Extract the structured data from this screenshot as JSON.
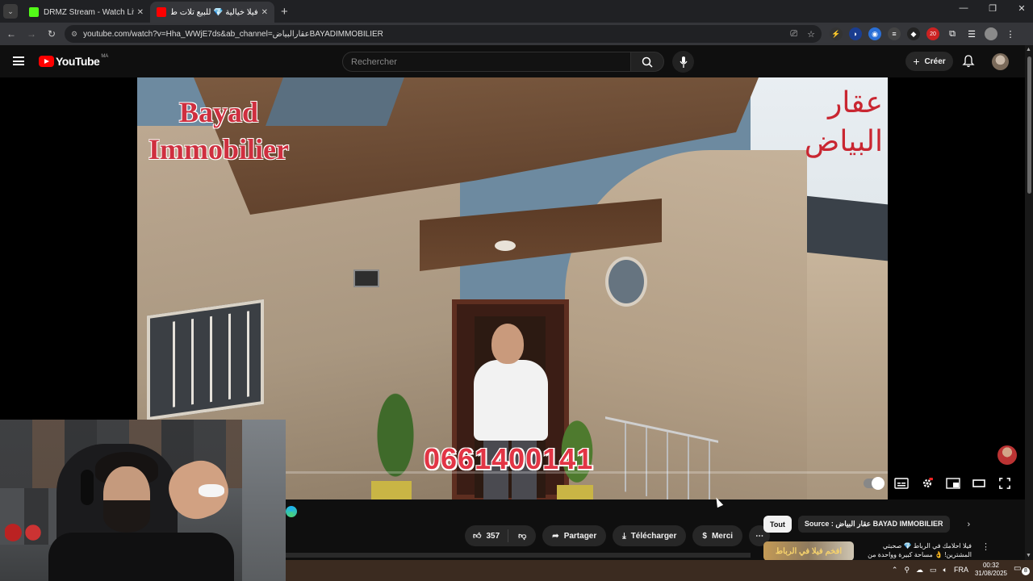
{
  "browser": {
    "tabs": [
      {
        "title": "DRMZ Stream - Watch Live on K",
        "favicon_color": "#53fc18",
        "active": false
      },
      {
        "title": "فيلا خيالية 💎 للبيع تلات طو",
        "favicon_color": "#ff0000",
        "active": true
      }
    ],
    "new_tab": "+",
    "url": "youtube.com/watch?v=Hha_WWjE7ds&ab_channel=عقارالبياضBAYADIMMOBILIER",
    "extension_badge": "20"
  },
  "youtube": {
    "logo_text": "YouTube",
    "country_code": "MA",
    "search_placeholder": "Rechercher",
    "create_label": "Créer",
    "accent": "#ff0000"
  },
  "video": {
    "overlay_title_en": "Bayad\nImmobilier",
    "overlay_title_ar": "عقار\nالبياض",
    "overlay_phone": "0661400141"
  },
  "actions": {
    "likes": "357",
    "share": "Partager",
    "download": "Télécharger",
    "thanks": "Merci"
  },
  "chips": {
    "all": "Tout",
    "source": "Source : عقار البياض BAYAD IMMOBILIER"
  },
  "recommendation": {
    "thumb_text": "افخم فيلا في الرباط",
    "title": "فيلا احلامك في الرباط 💎 صحبتي المشترين! 👌 مساحة كبيرة وواحدة من"
  },
  "taskbar": {
    "language": "FRA",
    "time": "00:32",
    "date": "31/08/2025",
    "notifications": "8"
  }
}
